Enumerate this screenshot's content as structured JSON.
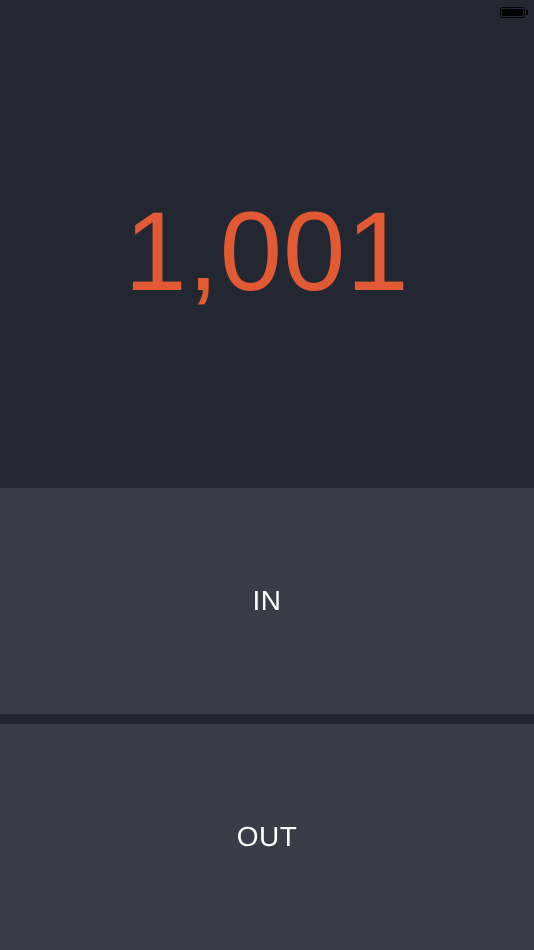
{
  "status_bar": {
    "battery_icon": "battery-full-icon"
  },
  "counter": {
    "value": "1,001",
    "color": "#e25a33"
  },
  "buttons": {
    "in_label": "IN",
    "out_label": "OUT"
  },
  "colors": {
    "background": "#222731",
    "button_background": "#393d47",
    "button_text": "#ffffff"
  }
}
